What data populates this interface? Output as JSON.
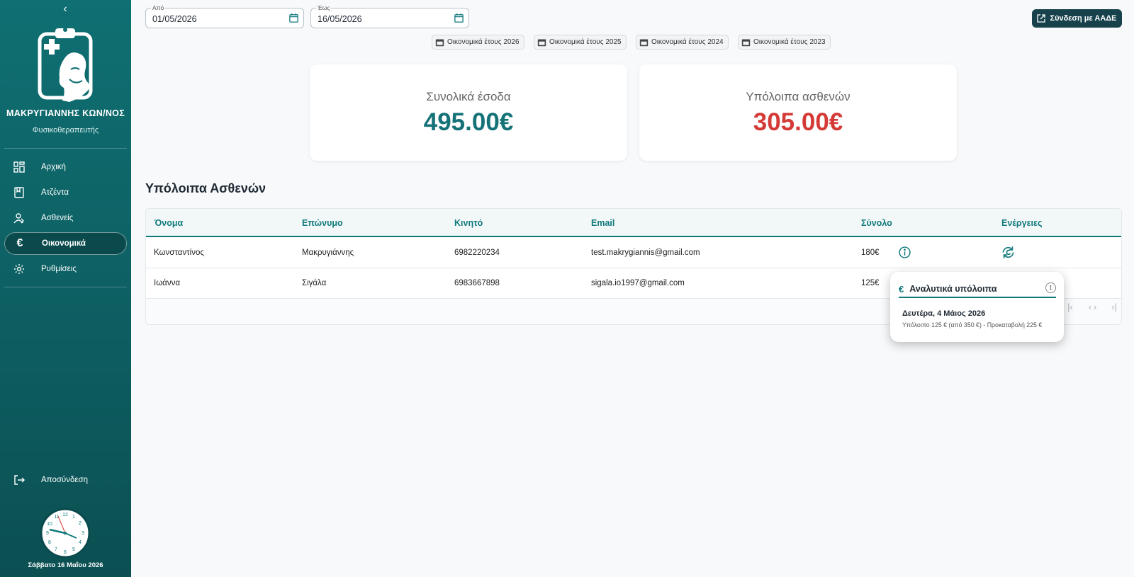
{
  "sidebar": {
    "doctor_name": "ΜΑΚΡΥΓΙΑΝΝΗΣ ΚΩΝ/ΝΟΣ",
    "doctor_role": "Φυσικοθεραπευτής",
    "items": [
      {
        "label": "Αρχική",
        "icon": "dashboard-icon"
      },
      {
        "label": "Ατζέντα",
        "icon": "book-icon"
      },
      {
        "label": "Ασθενείς",
        "icon": "users-icon"
      },
      {
        "label": "Οικονομικά",
        "icon": "euro-icon",
        "active": true
      },
      {
        "label": "Ρυθμίσεις",
        "icon": "gear-icon"
      }
    ],
    "logout_label": "Αποσύνδεση",
    "date_text": "Σάββατο 16 Μαΐου 2026"
  },
  "filters": {
    "from_label": "Από",
    "from_value": "01/05/2026",
    "to_label": "Έως",
    "to_value": "16/05/2026",
    "year_chips": [
      "Οικονομικά έτους 2026",
      "Οικονομικά έτους 2025",
      "Οικονομικά έτους 2024",
      "Οικονομικά έτους 2023"
    ]
  },
  "aade_button": "Σύνδεση με ΑΑΔΕ",
  "cards": {
    "income_title": "Συνολικά έσοδα",
    "income_value": "495.00€",
    "balance_title": "Υπόλοιπα ασθενών",
    "balance_value": "305.00€"
  },
  "colors": {
    "accent": "#127a7c",
    "income": "#157378",
    "balance": "#d43a36"
  },
  "section_title": "Υπόλοιπα Ασθενών",
  "table": {
    "headers": [
      "Όνομα",
      "Επώνυμο",
      "Κινητό",
      "Email",
      "Σύνολο",
      "Ενέργειες"
    ],
    "rows": [
      [
        "Κωνσταντίνος",
        "Μακρυγιάννης",
        "6982220234",
        "test.makrygiannis@gmail.com",
        "180€"
      ],
      [
        "Ιωάννα",
        "Σιγάλα",
        "6983667898",
        "sigala.io1997@gmail.com",
        "125€"
      ]
    ]
  },
  "popup": {
    "title": "Αναλυτικά υπόλοιπα",
    "count": "1",
    "entry_date": "Δευτέρα, 4 Μάιος 2026",
    "entry_detail": "Υπόλοιπο 125 € (από 350 €) - Προκαταβολή 225 €"
  }
}
